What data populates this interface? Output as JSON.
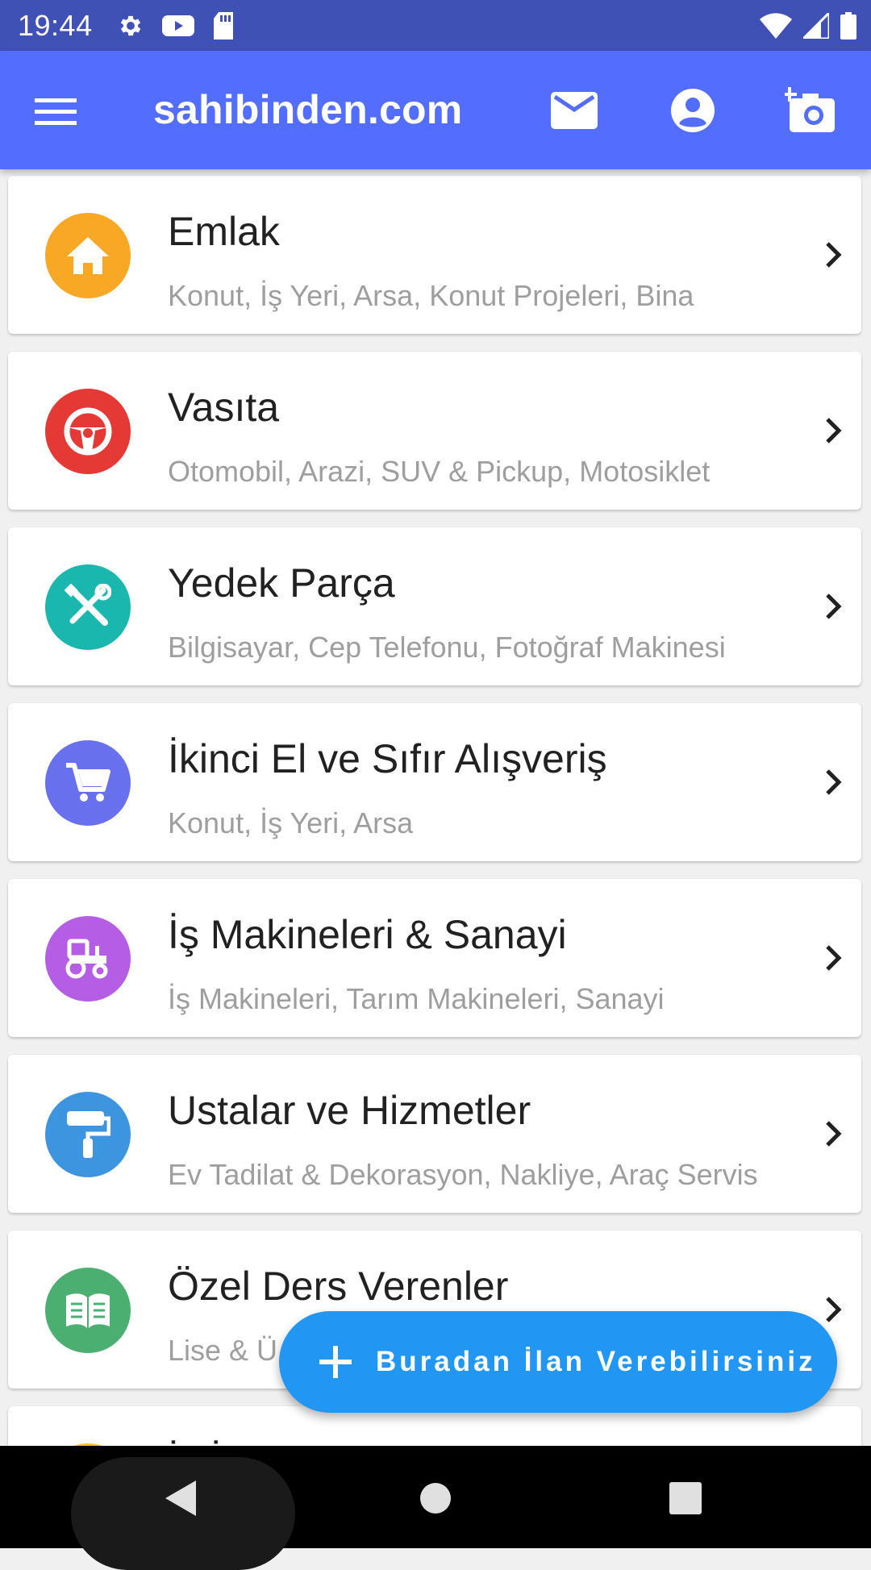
{
  "status_bar": {
    "time": "19:44",
    "left_icons": [
      "settings-icon",
      "youtube-icon",
      "sd-card-icon"
    ],
    "right_icons": [
      "wifi-icon",
      "signal-icon",
      "battery-icon"
    ],
    "background": "#3f51b5"
  },
  "app_bar": {
    "title": "sahibinden.com",
    "background": "#536dfe",
    "icons": [
      "menu-icon",
      "mail-icon",
      "account-icon",
      "add-photo-icon"
    ]
  },
  "categories": [
    {
      "title": "Emlak",
      "subtitle": "Konut, İş Yeri, Arsa, Konut Projeleri, Bina",
      "color": "#f9a825",
      "icon": "home-icon"
    },
    {
      "title": "Vasıta",
      "subtitle": "Otomobil, Arazi, SUV & Pickup, Motosiklet",
      "color": "#e53935",
      "icon": "steering-wheel-icon"
    },
    {
      "title": "Yedek Parça",
      "subtitle": "Bilgisayar, Cep Telefonu, Fotoğraf Makinesi",
      "color": "#1ab7ae",
      "icon": "tools-icon"
    },
    {
      "title": "İkinci El ve Sıfır Alışveriş",
      "subtitle": "Konut, İş Yeri, Arsa",
      "color": "#6870ee",
      "icon": "cart-icon"
    },
    {
      "title": "İş Makineleri & Sanayi",
      "subtitle": "İş Makineleri, Tarım Makineleri, Sanayi",
      "color": "#b55ee5",
      "icon": "tractor-icon"
    },
    {
      "title": "Ustalar ve Hizmetler",
      "subtitle": "Ev Tadilat & Dekorasyon, Nakliye, Araç Servis",
      "color": "#3d95e0",
      "icon": "paint-roller-icon"
    },
    {
      "title": "Özel Ders Verenler",
      "subtitle": "Lise & Ü",
      "color": "#4caf72",
      "icon": "book-icon"
    },
    {
      "title": "İş İ",
      "subtitle": "",
      "color": "#fbc02d",
      "icon": "briefcase-icon"
    }
  ],
  "fab": {
    "label": "Buradan İlan Verebilirsiniz",
    "color": "#2196f3",
    "icon": "plus-icon"
  },
  "nav_bar": {
    "icons": [
      "back-icon",
      "home-icon",
      "recents-icon"
    ]
  }
}
